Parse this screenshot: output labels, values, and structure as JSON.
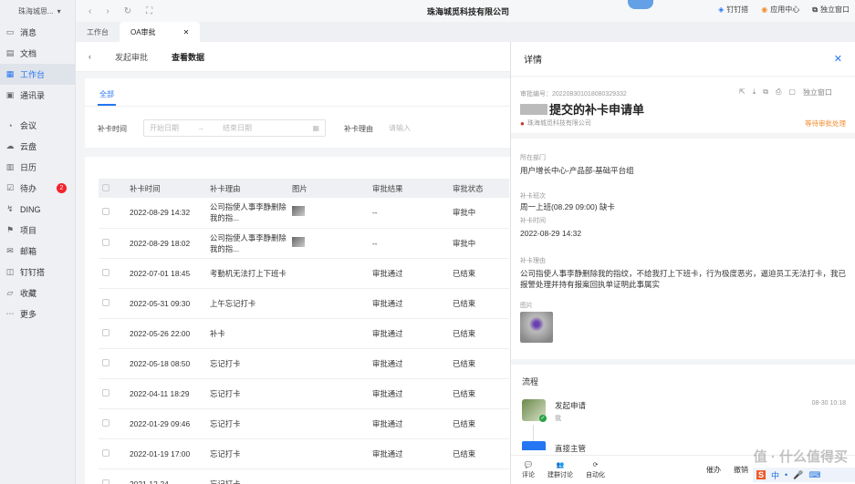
{
  "sidebar": {
    "org": "珠海城思...",
    "items": [
      {
        "label": "消息",
        "icon": "message-icon"
      },
      {
        "label": "文档",
        "icon": "doc-icon"
      },
      {
        "label": "工作台",
        "icon": "workbench-icon",
        "active": true
      },
      {
        "label": "通讯录",
        "icon": "contacts-icon"
      },
      {
        "label": "会议",
        "icon": "meeting-icon"
      },
      {
        "label": "云盘",
        "icon": "cloud-icon"
      },
      {
        "label": "日历",
        "icon": "calendar-icon"
      },
      {
        "label": "待办",
        "icon": "todo-icon",
        "badge": "2"
      },
      {
        "label": "DING",
        "icon": "ding-icon"
      },
      {
        "label": "项目",
        "icon": "project-icon"
      },
      {
        "label": "邮箱",
        "icon": "mail-icon"
      },
      {
        "label": "钉钉搭",
        "icon": "builder-icon"
      },
      {
        "label": "收藏",
        "icon": "favorite-icon"
      },
      {
        "label": "更多",
        "icon": "more-icon"
      }
    ]
  },
  "topbar": {
    "company": "珠海城觅科技有限公司",
    "right": [
      "钉钉搭",
      "应用中心",
      "独立窗口"
    ]
  },
  "tabs": [
    "工作台",
    "OA审批"
  ],
  "subhead": {
    "tab1": "发起审批",
    "tab2": "查看数据"
  },
  "filter": {
    "tab_all": "全部",
    "label_time": "补卡时间",
    "start_placeholder": "开始日期",
    "end_placeholder": "结束日期",
    "label_reason": "补卡理由",
    "reason_placeholder": "请输入"
  },
  "table": {
    "headers": [
      "补卡时间",
      "补卡理由",
      "图片",
      "审批结果",
      "审批状态"
    ],
    "rows": [
      {
        "time": "2022-08-29 14:32",
        "reason": "公司指使人事李静删除我的指...",
        "image": true,
        "result": "--",
        "status": "审批中"
      },
      {
        "time": "2022-08-29 18:02",
        "reason": "公司指使人事李静删除我的指...",
        "image": true,
        "result": "--",
        "status": "审批中"
      },
      {
        "time": "2022-07-01 18:45",
        "reason": "考勤机无法打上下班卡",
        "image": false,
        "result": "审批通过",
        "status": "已结束"
      },
      {
        "time": "2022-05-31 09:30",
        "reason": "上午忘记打卡",
        "image": false,
        "result": "审批通过",
        "status": "已结束"
      },
      {
        "time": "2022-05-26 22:00",
        "reason": "补卡",
        "image": false,
        "result": "审批通过",
        "status": "已结束"
      },
      {
        "time": "2022-05-18 08:50",
        "reason": "忘记打卡",
        "image": false,
        "result": "审批通过",
        "status": "已结束"
      },
      {
        "time": "2022-04-11 18:29",
        "reason": "忘记打卡",
        "image": false,
        "result": "审批通过",
        "status": "已结束"
      },
      {
        "time": "2022-01-29 09:46",
        "reason": "忘记打卡",
        "image": false,
        "result": "审批通过",
        "status": "已结束"
      },
      {
        "time": "2022-01-19 17:00",
        "reason": "忘记打卡",
        "image": false,
        "result": "审批通过",
        "status": "已结束"
      },
      {
        "time": "2021-12-24",
        "reason": "忘记打卡",
        "image": false,
        "result": "",
        "status": ""
      }
    ]
  },
  "panel": {
    "title": "详情",
    "serial": "审批编号：202208301018080329332",
    "actions": [
      "独立窗口"
    ],
    "heading": "提交的补卡申请单",
    "company": "珠海城觅科技有限公司",
    "pending": "等待审批处理",
    "dept_label": "所在部门",
    "dept": "用户增长中心-产品部-基础平台组",
    "shift_label": "补卡班次",
    "shift": "周一上班(08.29 09:00) 缺卡",
    "time_label": "补卡时间",
    "time": "2022-08-29 14:32",
    "reason_label": "补卡理由",
    "reason": "公司指使人事李静删除我的指纹，不给我打上下班卡，行为极度恶劣，逼迫员工无法打卡，我已报警处理并持有报案回执单证明此事属实",
    "image_label": "图片",
    "flow_label": "流程",
    "flow_step": "发起申请",
    "flow_sub": "我",
    "flow_time": "08-30 10:18",
    "flow_next": "直接主管",
    "foot": [
      "评论",
      "建群讨论",
      "自动化"
    ],
    "foot_right": [
      "催办",
      "撤销"
    ]
  },
  "ime": {
    "text": "中"
  },
  "watermark": "值 · 什么值得买"
}
